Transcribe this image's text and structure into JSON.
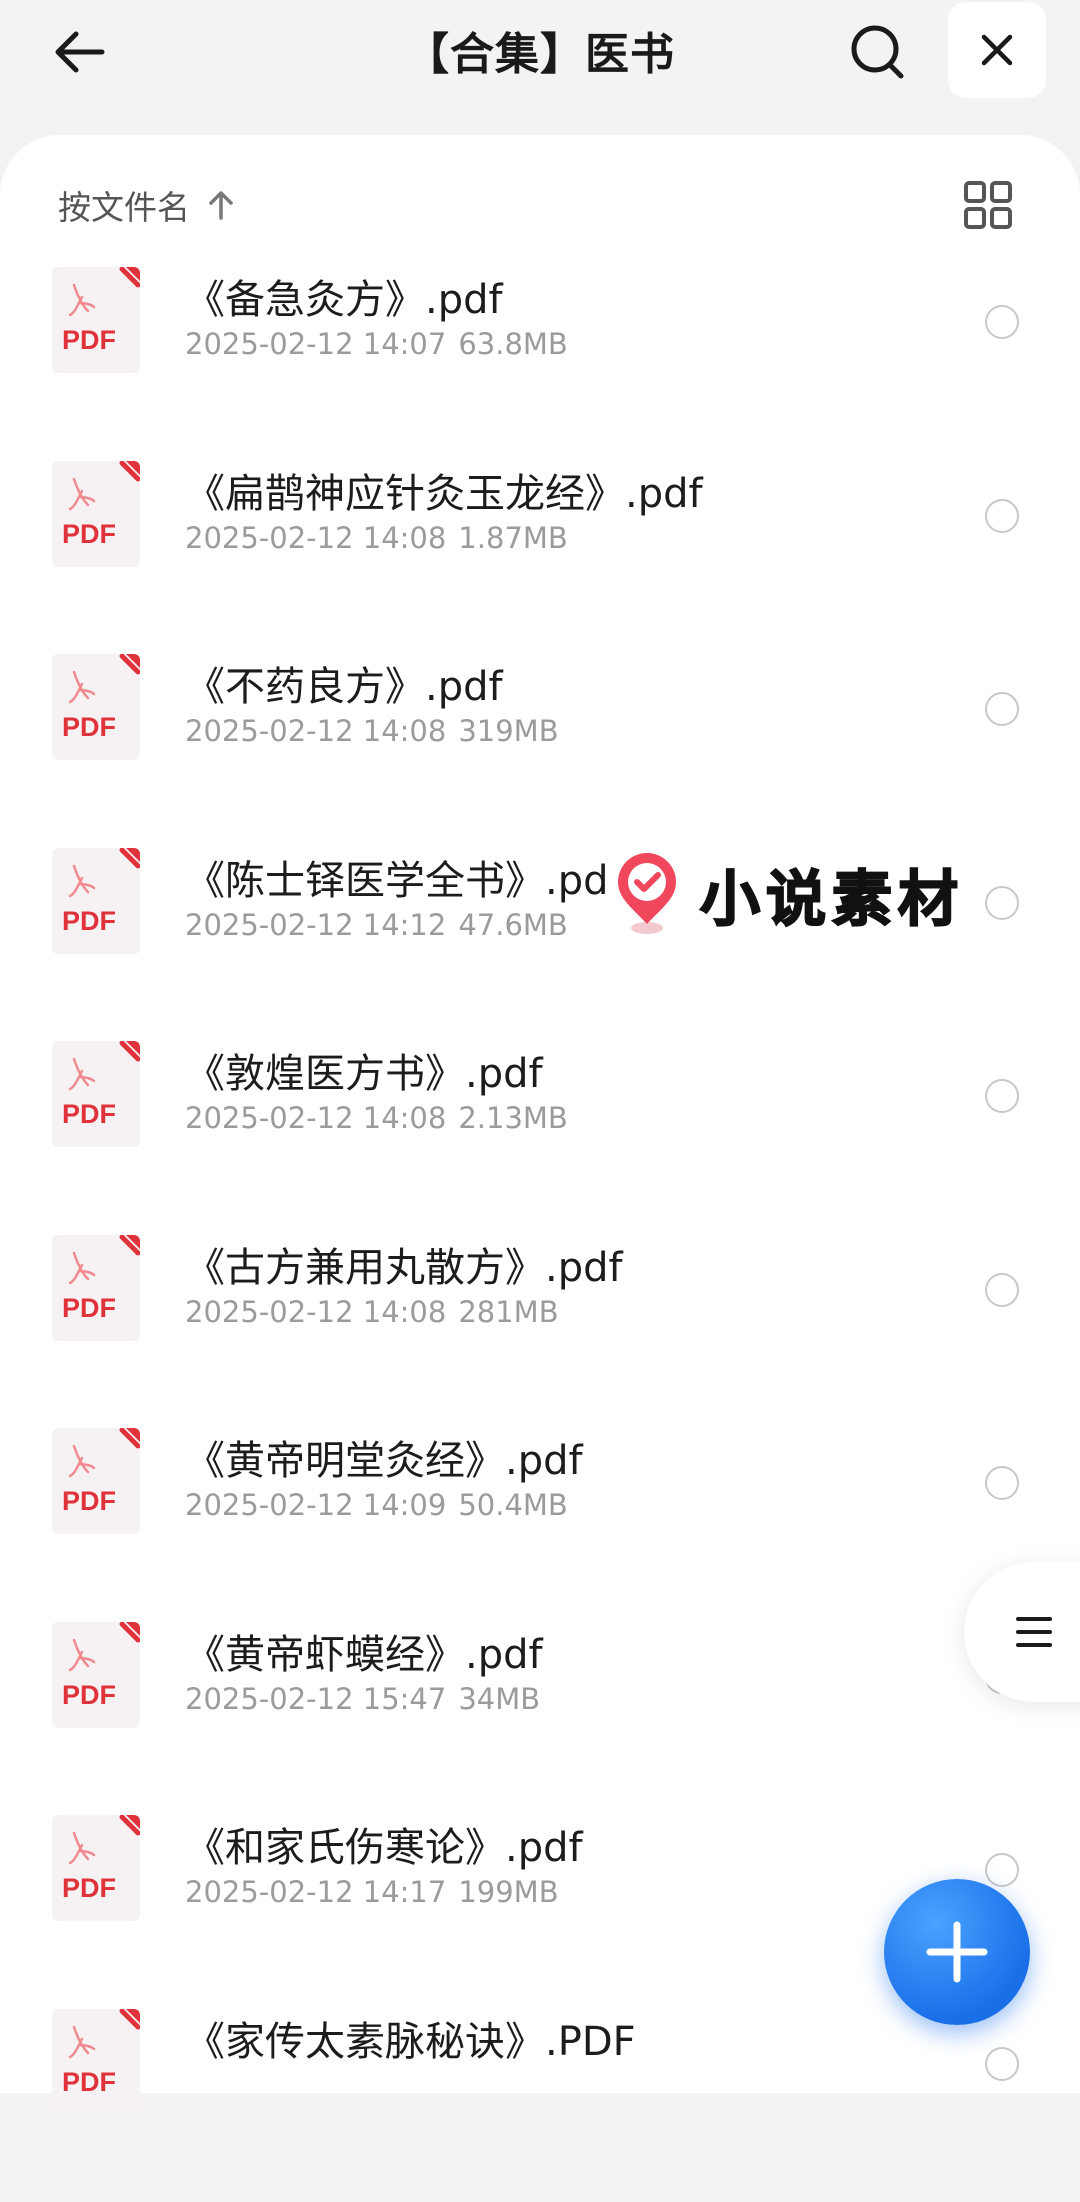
{
  "header": {
    "title": "【合集】医书",
    "back_icon": "arrow-left-icon",
    "search_icon": "search-icon",
    "close_icon": "close-icon"
  },
  "sort": {
    "label": "按文件名",
    "direction_icon": "arrow-up-icon",
    "view_icon": "grid-view-icon"
  },
  "files": [
    {
      "name": "《备急灸方》.pdf",
      "date": "2025-02-12 14:07",
      "size": "63.8MB",
      "icon_label": "PDF"
    },
    {
      "name": "《扁鹊神应针灸玉龙经》.pdf",
      "date": "2025-02-12 14:08",
      "size": "1.87MB",
      "icon_label": "PDF"
    },
    {
      "name": "《不药良方》.pdf",
      "date": "2025-02-12 14:08",
      "size": "319MB",
      "icon_label": "PDF"
    },
    {
      "name": "《陈士铎医学全书》.pd",
      "date": "2025-02-12 14:12",
      "size": "47.6MB",
      "icon_label": "PDF"
    },
    {
      "name": "《敦煌医方书》.pdf",
      "date": "2025-02-12 14:08",
      "size": "2.13MB",
      "icon_label": "PDF"
    },
    {
      "name": "《古方兼用丸散方》.pdf",
      "date": "2025-02-12 14:08",
      "size": "281MB",
      "icon_label": "PDF"
    },
    {
      "name": "《黄帝明堂灸经》.pdf",
      "date": "2025-02-12 14:09",
      "size": "50.4MB",
      "icon_label": "PDF"
    },
    {
      "name": "《黄帝虾蟆经》.pdf",
      "date": "2025-02-12 15:47",
      "size": "34MB",
      "icon_label": "PDF"
    },
    {
      "name": "《和家氏伤寒论》.pdf",
      "date": "2025-02-12 14:17",
      "size": "199MB",
      "icon_label": "PDF"
    },
    {
      "name": "《家传太素脉秘诀》.PDF",
      "date": "",
      "size": "",
      "icon_label": "PDF"
    }
  ],
  "watermark": {
    "text": "小说素材",
    "icon": "check-pin-icon"
  },
  "floating": {
    "menu_icon": "menu-icon",
    "add_icon": "plus-icon"
  },
  "colors": {
    "pdf_red": "#e0323a",
    "fab_blue": "#1a6fe8",
    "meta_gray": "#9b9b9b"
  }
}
